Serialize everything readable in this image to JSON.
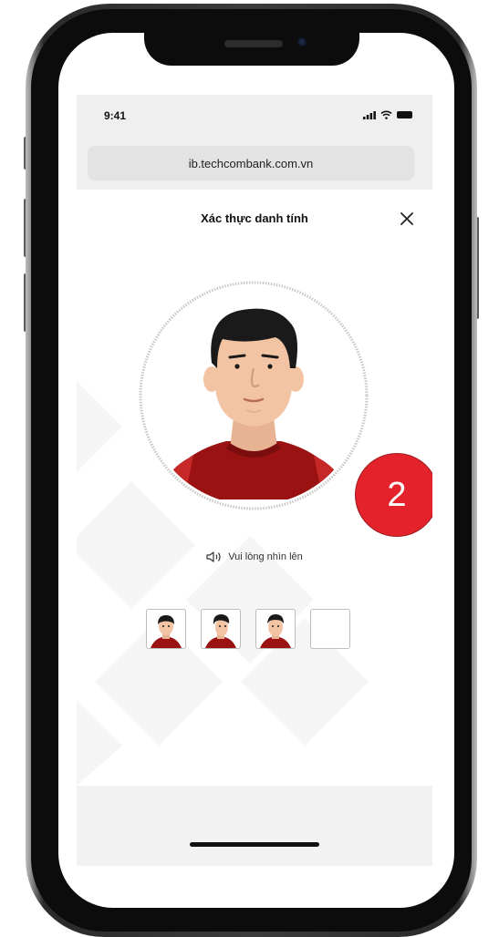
{
  "status_bar": {
    "time": "9:41",
    "icons": [
      "signal-icon",
      "wifi-icon",
      "battery-icon"
    ]
  },
  "browser": {
    "url": "ib.techcombank.com.vn"
  },
  "header": {
    "title": "Xác thực danh tính",
    "close_icon": "close-icon"
  },
  "face_capture": {
    "step_badge": "2",
    "instruction": "Vui lòng nhìn lên",
    "instruction_icon": "speaker-icon"
  },
  "thumbnails": [
    {
      "state": "captured",
      "pose": "front"
    },
    {
      "state": "captured",
      "pose": "side"
    },
    {
      "state": "captured",
      "pose": "front"
    },
    {
      "state": "empty",
      "pose": ""
    }
  ],
  "colors": {
    "accent": "#e3222b",
    "shirt": "#9b1212",
    "skin": "#f2c4a4",
    "hair": "#1a1a1a"
  }
}
